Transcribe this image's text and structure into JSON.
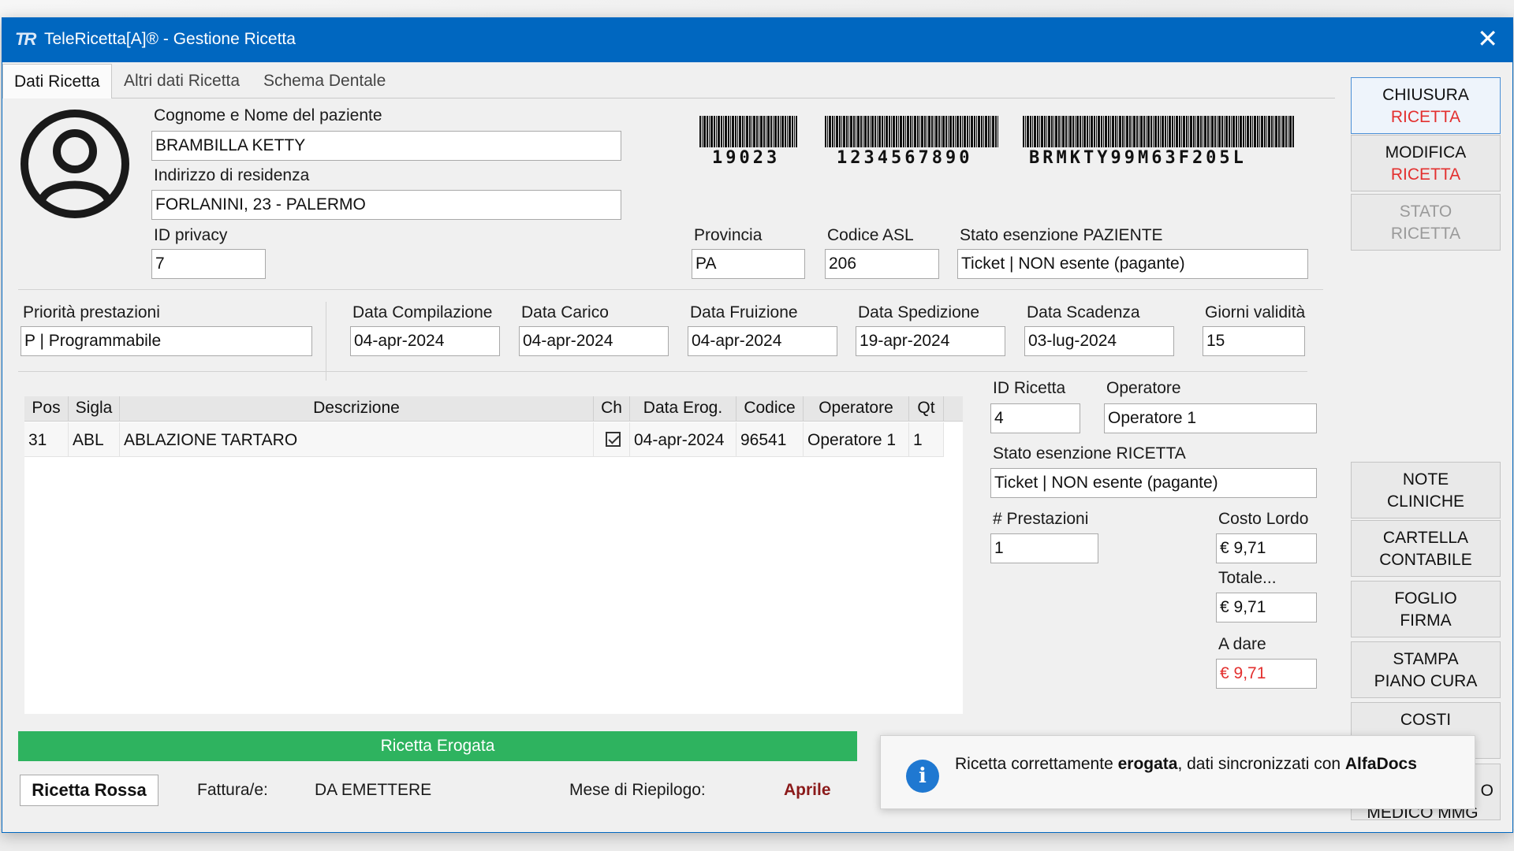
{
  "window": {
    "title": "TeleRicetta[A]® - Gestione Ricetta",
    "logo": "TR",
    "close_icon": "close-icon"
  },
  "tabs": [
    {
      "label": "Dati Ricetta",
      "active": true
    },
    {
      "label": "Altri dati Ricetta",
      "active": false
    },
    {
      "label": "Schema Dentale",
      "active": false
    }
  ],
  "patient": {
    "name_label": "Cognome e Nome del paziente",
    "name": "BRAMBILLA KETTY",
    "address_label": "Indirizzo di residenza",
    "address": "FORLANINI, 23 - PALERMO",
    "privacy_label": "ID privacy",
    "privacy": "7",
    "province_label": "Provincia",
    "province": "PA",
    "asl_label": "Codice ASL",
    "asl": "206",
    "exemption_label": "Stato esenzione PAZIENTE",
    "exemption": "Ticket | NON esente (pagante)"
  },
  "barcodes": [
    "19023",
    "1234567890",
    "BRMKTY99M63F205L"
  ],
  "dates": {
    "priority_label": "Priorità prestazioni",
    "priority": "P | Programmabile",
    "compilation_label": "Data Compilazione",
    "compilation": "04-apr-2024",
    "load_label": "Data Carico",
    "load": "04-apr-2024",
    "fruition_label": "Data Fruizione",
    "fruition": "04-apr-2024",
    "shipping_label": "Data Spedizione",
    "shipping": "19-apr-2024",
    "expiry_label": "Data Scadenza",
    "expiry": "03-lug-2024",
    "validity_label": "Giorni validità",
    "validity": "15"
  },
  "grid": {
    "headers": [
      "Pos",
      "Sigla",
      "Descrizione",
      "Ch",
      "Data Erog.",
      "Codice",
      "Operatore",
      "Qt"
    ],
    "rows": [
      {
        "pos": "31",
        "sigla": "ABL",
        "descrizione": "ABLAZIONE TARTARO",
        "checked": true,
        "data": "04-apr-2024",
        "codice": "96541",
        "operatore": "Operatore 1",
        "qt": "1"
      }
    ]
  },
  "recipe": {
    "id_label": "ID Ricetta",
    "id": "4",
    "operator_label": "Operatore",
    "operator": "Operatore 1",
    "exemption_label": "Stato esenzione RICETTA",
    "exemption": "Ticket | NON esente (pagante)",
    "count_label": "# Prestazioni",
    "count": "1",
    "gross_label": "Costo Lordo",
    "gross": "€ 9,71",
    "total_label": "Totale...",
    "total": "€ 9,71",
    "due_label": "A dare",
    "due": "€ 9,71",
    "due_color": "#e3302f"
  },
  "side_buttons": [
    {
      "l1": "CHIUSURA",
      "l2": "RICETTA"
    },
    {
      "l1": "MODIFICA",
      "l2": "RICETTA"
    },
    {
      "l1": "STATO",
      "l2": "RICETTA"
    },
    {
      "l1": "NOTE",
      "l2": "CLINICHE"
    },
    {
      "l1": "CARTELLA",
      "l2": "CONTABILE"
    },
    {
      "l1": "FOGLIO",
      "l2": "FIRMA"
    },
    {
      "l1": "STAMPA",
      "l2": "PIANO CURA"
    },
    {
      "l1": "COSTI",
      "l2": ""
    },
    {
      "l1": "O",
      "l2": "MEDICO MMG"
    }
  ],
  "status": {
    "text": "Ricetta Erogata",
    "color": "#2eb35f",
    "rossa_label": "Ricetta Rossa",
    "invoice_label": "Fattura/e:",
    "invoice": "DA EMETTERE",
    "month_label": "Mese di Riepilogo:",
    "month": "Aprile",
    "month_color": "#8b1a1a"
  },
  "toast": {
    "icon": "info-icon",
    "before": "Ricetta correttamente ",
    "bold1": "erogata",
    "middle": ", dati sincronizzati con ",
    "bold2": "AlfaDocs"
  },
  "accent_color": "#0067c0"
}
